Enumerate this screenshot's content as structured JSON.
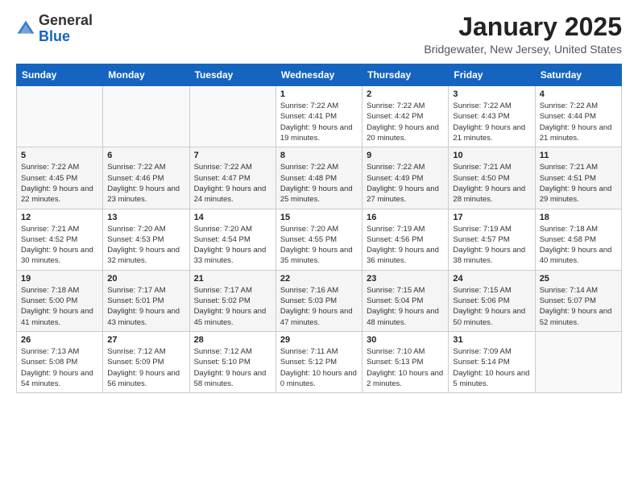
{
  "header": {
    "logo_general": "General",
    "logo_blue": "Blue",
    "month": "January 2025",
    "location": "Bridgewater, New Jersey, United States"
  },
  "weekdays": [
    "Sunday",
    "Monday",
    "Tuesday",
    "Wednesday",
    "Thursday",
    "Friday",
    "Saturday"
  ],
  "weeks": [
    [
      {
        "day": "",
        "sunrise": "",
        "sunset": "",
        "daylight": ""
      },
      {
        "day": "",
        "sunrise": "",
        "sunset": "",
        "daylight": ""
      },
      {
        "day": "",
        "sunrise": "",
        "sunset": "",
        "daylight": ""
      },
      {
        "day": "1",
        "sunrise": "Sunrise: 7:22 AM",
        "sunset": "Sunset: 4:41 PM",
        "daylight": "Daylight: 9 hours and 19 minutes."
      },
      {
        "day": "2",
        "sunrise": "Sunrise: 7:22 AM",
        "sunset": "Sunset: 4:42 PM",
        "daylight": "Daylight: 9 hours and 20 minutes."
      },
      {
        "day": "3",
        "sunrise": "Sunrise: 7:22 AM",
        "sunset": "Sunset: 4:43 PM",
        "daylight": "Daylight: 9 hours and 21 minutes."
      },
      {
        "day": "4",
        "sunrise": "Sunrise: 7:22 AM",
        "sunset": "Sunset: 4:44 PM",
        "daylight": "Daylight: 9 hours and 21 minutes."
      }
    ],
    [
      {
        "day": "5",
        "sunrise": "Sunrise: 7:22 AM",
        "sunset": "Sunset: 4:45 PM",
        "daylight": "Daylight: 9 hours and 22 minutes."
      },
      {
        "day": "6",
        "sunrise": "Sunrise: 7:22 AM",
        "sunset": "Sunset: 4:46 PM",
        "daylight": "Daylight: 9 hours and 23 minutes."
      },
      {
        "day": "7",
        "sunrise": "Sunrise: 7:22 AM",
        "sunset": "Sunset: 4:47 PM",
        "daylight": "Daylight: 9 hours and 24 minutes."
      },
      {
        "day": "8",
        "sunrise": "Sunrise: 7:22 AM",
        "sunset": "Sunset: 4:48 PM",
        "daylight": "Daylight: 9 hours and 25 minutes."
      },
      {
        "day": "9",
        "sunrise": "Sunrise: 7:22 AM",
        "sunset": "Sunset: 4:49 PM",
        "daylight": "Daylight: 9 hours and 27 minutes."
      },
      {
        "day": "10",
        "sunrise": "Sunrise: 7:21 AM",
        "sunset": "Sunset: 4:50 PM",
        "daylight": "Daylight: 9 hours and 28 minutes."
      },
      {
        "day": "11",
        "sunrise": "Sunrise: 7:21 AM",
        "sunset": "Sunset: 4:51 PM",
        "daylight": "Daylight: 9 hours and 29 minutes."
      }
    ],
    [
      {
        "day": "12",
        "sunrise": "Sunrise: 7:21 AM",
        "sunset": "Sunset: 4:52 PM",
        "daylight": "Daylight: 9 hours and 30 minutes."
      },
      {
        "day": "13",
        "sunrise": "Sunrise: 7:20 AM",
        "sunset": "Sunset: 4:53 PM",
        "daylight": "Daylight: 9 hours and 32 minutes."
      },
      {
        "day": "14",
        "sunrise": "Sunrise: 7:20 AM",
        "sunset": "Sunset: 4:54 PM",
        "daylight": "Daylight: 9 hours and 33 minutes."
      },
      {
        "day": "15",
        "sunrise": "Sunrise: 7:20 AM",
        "sunset": "Sunset: 4:55 PM",
        "daylight": "Daylight: 9 hours and 35 minutes."
      },
      {
        "day": "16",
        "sunrise": "Sunrise: 7:19 AM",
        "sunset": "Sunset: 4:56 PM",
        "daylight": "Daylight: 9 hours and 36 minutes."
      },
      {
        "day": "17",
        "sunrise": "Sunrise: 7:19 AM",
        "sunset": "Sunset: 4:57 PM",
        "daylight": "Daylight: 9 hours and 38 minutes."
      },
      {
        "day": "18",
        "sunrise": "Sunrise: 7:18 AM",
        "sunset": "Sunset: 4:58 PM",
        "daylight": "Daylight: 9 hours and 40 minutes."
      }
    ],
    [
      {
        "day": "19",
        "sunrise": "Sunrise: 7:18 AM",
        "sunset": "Sunset: 5:00 PM",
        "daylight": "Daylight: 9 hours and 41 minutes."
      },
      {
        "day": "20",
        "sunrise": "Sunrise: 7:17 AM",
        "sunset": "Sunset: 5:01 PM",
        "daylight": "Daylight: 9 hours and 43 minutes."
      },
      {
        "day": "21",
        "sunrise": "Sunrise: 7:17 AM",
        "sunset": "Sunset: 5:02 PM",
        "daylight": "Daylight: 9 hours and 45 minutes."
      },
      {
        "day": "22",
        "sunrise": "Sunrise: 7:16 AM",
        "sunset": "Sunset: 5:03 PM",
        "daylight": "Daylight: 9 hours and 47 minutes."
      },
      {
        "day": "23",
        "sunrise": "Sunrise: 7:15 AM",
        "sunset": "Sunset: 5:04 PM",
        "daylight": "Daylight: 9 hours and 48 minutes."
      },
      {
        "day": "24",
        "sunrise": "Sunrise: 7:15 AM",
        "sunset": "Sunset: 5:06 PM",
        "daylight": "Daylight: 9 hours and 50 minutes."
      },
      {
        "day": "25",
        "sunrise": "Sunrise: 7:14 AM",
        "sunset": "Sunset: 5:07 PM",
        "daylight": "Daylight: 9 hours and 52 minutes."
      }
    ],
    [
      {
        "day": "26",
        "sunrise": "Sunrise: 7:13 AM",
        "sunset": "Sunset: 5:08 PM",
        "daylight": "Daylight: 9 hours and 54 minutes."
      },
      {
        "day": "27",
        "sunrise": "Sunrise: 7:12 AM",
        "sunset": "Sunset: 5:09 PM",
        "daylight": "Daylight: 9 hours and 56 minutes."
      },
      {
        "day": "28",
        "sunrise": "Sunrise: 7:12 AM",
        "sunset": "Sunset: 5:10 PM",
        "daylight": "Daylight: 9 hours and 58 minutes."
      },
      {
        "day": "29",
        "sunrise": "Sunrise: 7:11 AM",
        "sunset": "Sunset: 5:12 PM",
        "daylight": "Daylight: 10 hours and 0 minutes."
      },
      {
        "day": "30",
        "sunrise": "Sunrise: 7:10 AM",
        "sunset": "Sunset: 5:13 PM",
        "daylight": "Daylight: 10 hours and 2 minutes."
      },
      {
        "day": "31",
        "sunrise": "Sunrise: 7:09 AM",
        "sunset": "Sunset: 5:14 PM",
        "daylight": "Daylight: 10 hours and 5 minutes."
      },
      {
        "day": "",
        "sunrise": "",
        "sunset": "",
        "daylight": ""
      }
    ]
  ]
}
